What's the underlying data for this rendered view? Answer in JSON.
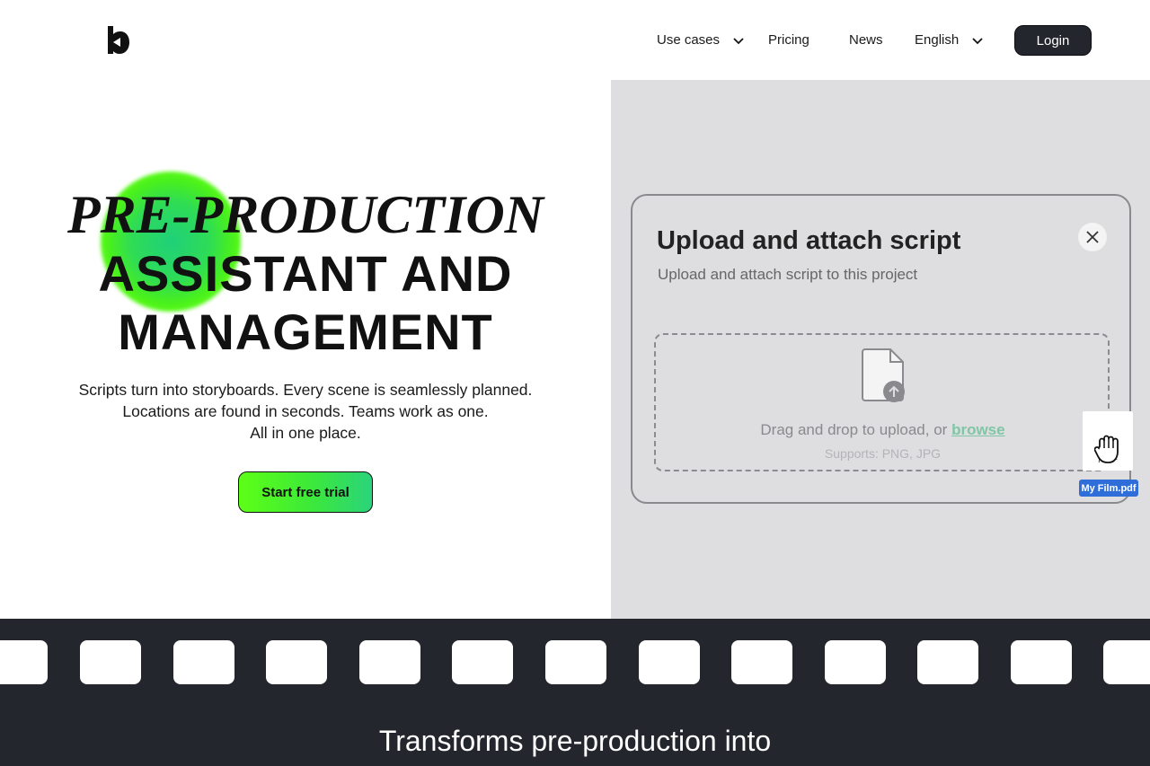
{
  "header": {
    "nav": [
      {
        "label": "Use cases",
        "has_dropdown": true
      },
      {
        "label": "Pricing",
        "has_dropdown": false
      },
      {
        "label": "News",
        "has_dropdown": false
      },
      {
        "label": "English",
        "has_dropdown": true
      }
    ],
    "login_label": "Login"
  },
  "hero": {
    "title_line1": "PRE-PRODUCTION",
    "title_line2": "ASSISTANT AND",
    "title_line3": "MANAGEMENT",
    "subtitle_line1": "Scripts turn into storyboards. Every scene is seamlessly planned.",
    "subtitle_line2": "Locations are found in seconds. Teams work as one.",
    "subtitle_line3": "All in one place.",
    "cta_label": "Start free trial",
    "accent_colors": [
      "#5cff10",
      "#2bd47c"
    ]
  },
  "upload_modal": {
    "title": "Upload and attach script",
    "subtitle": "Upload and attach script to this project",
    "drop_text": "Drag and drop to upload, or",
    "browse_label": "browse",
    "supports_text": "Supports: PNG, JPG",
    "dragged_file_type": "PDF",
    "dragged_file_name": "My Film.pdf",
    "icons": [
      "close-icon",
      "file-upload-icon",
      "grab-hand-icon"
    ]
  },
  "band": {
    "heading": "Transforms pre-production into"
  },
  "colors": {
    "dark": "#24262e",
    "panel_bg": "#dedee0",
    "file_tag": "#2f6ed8"
  }
}
